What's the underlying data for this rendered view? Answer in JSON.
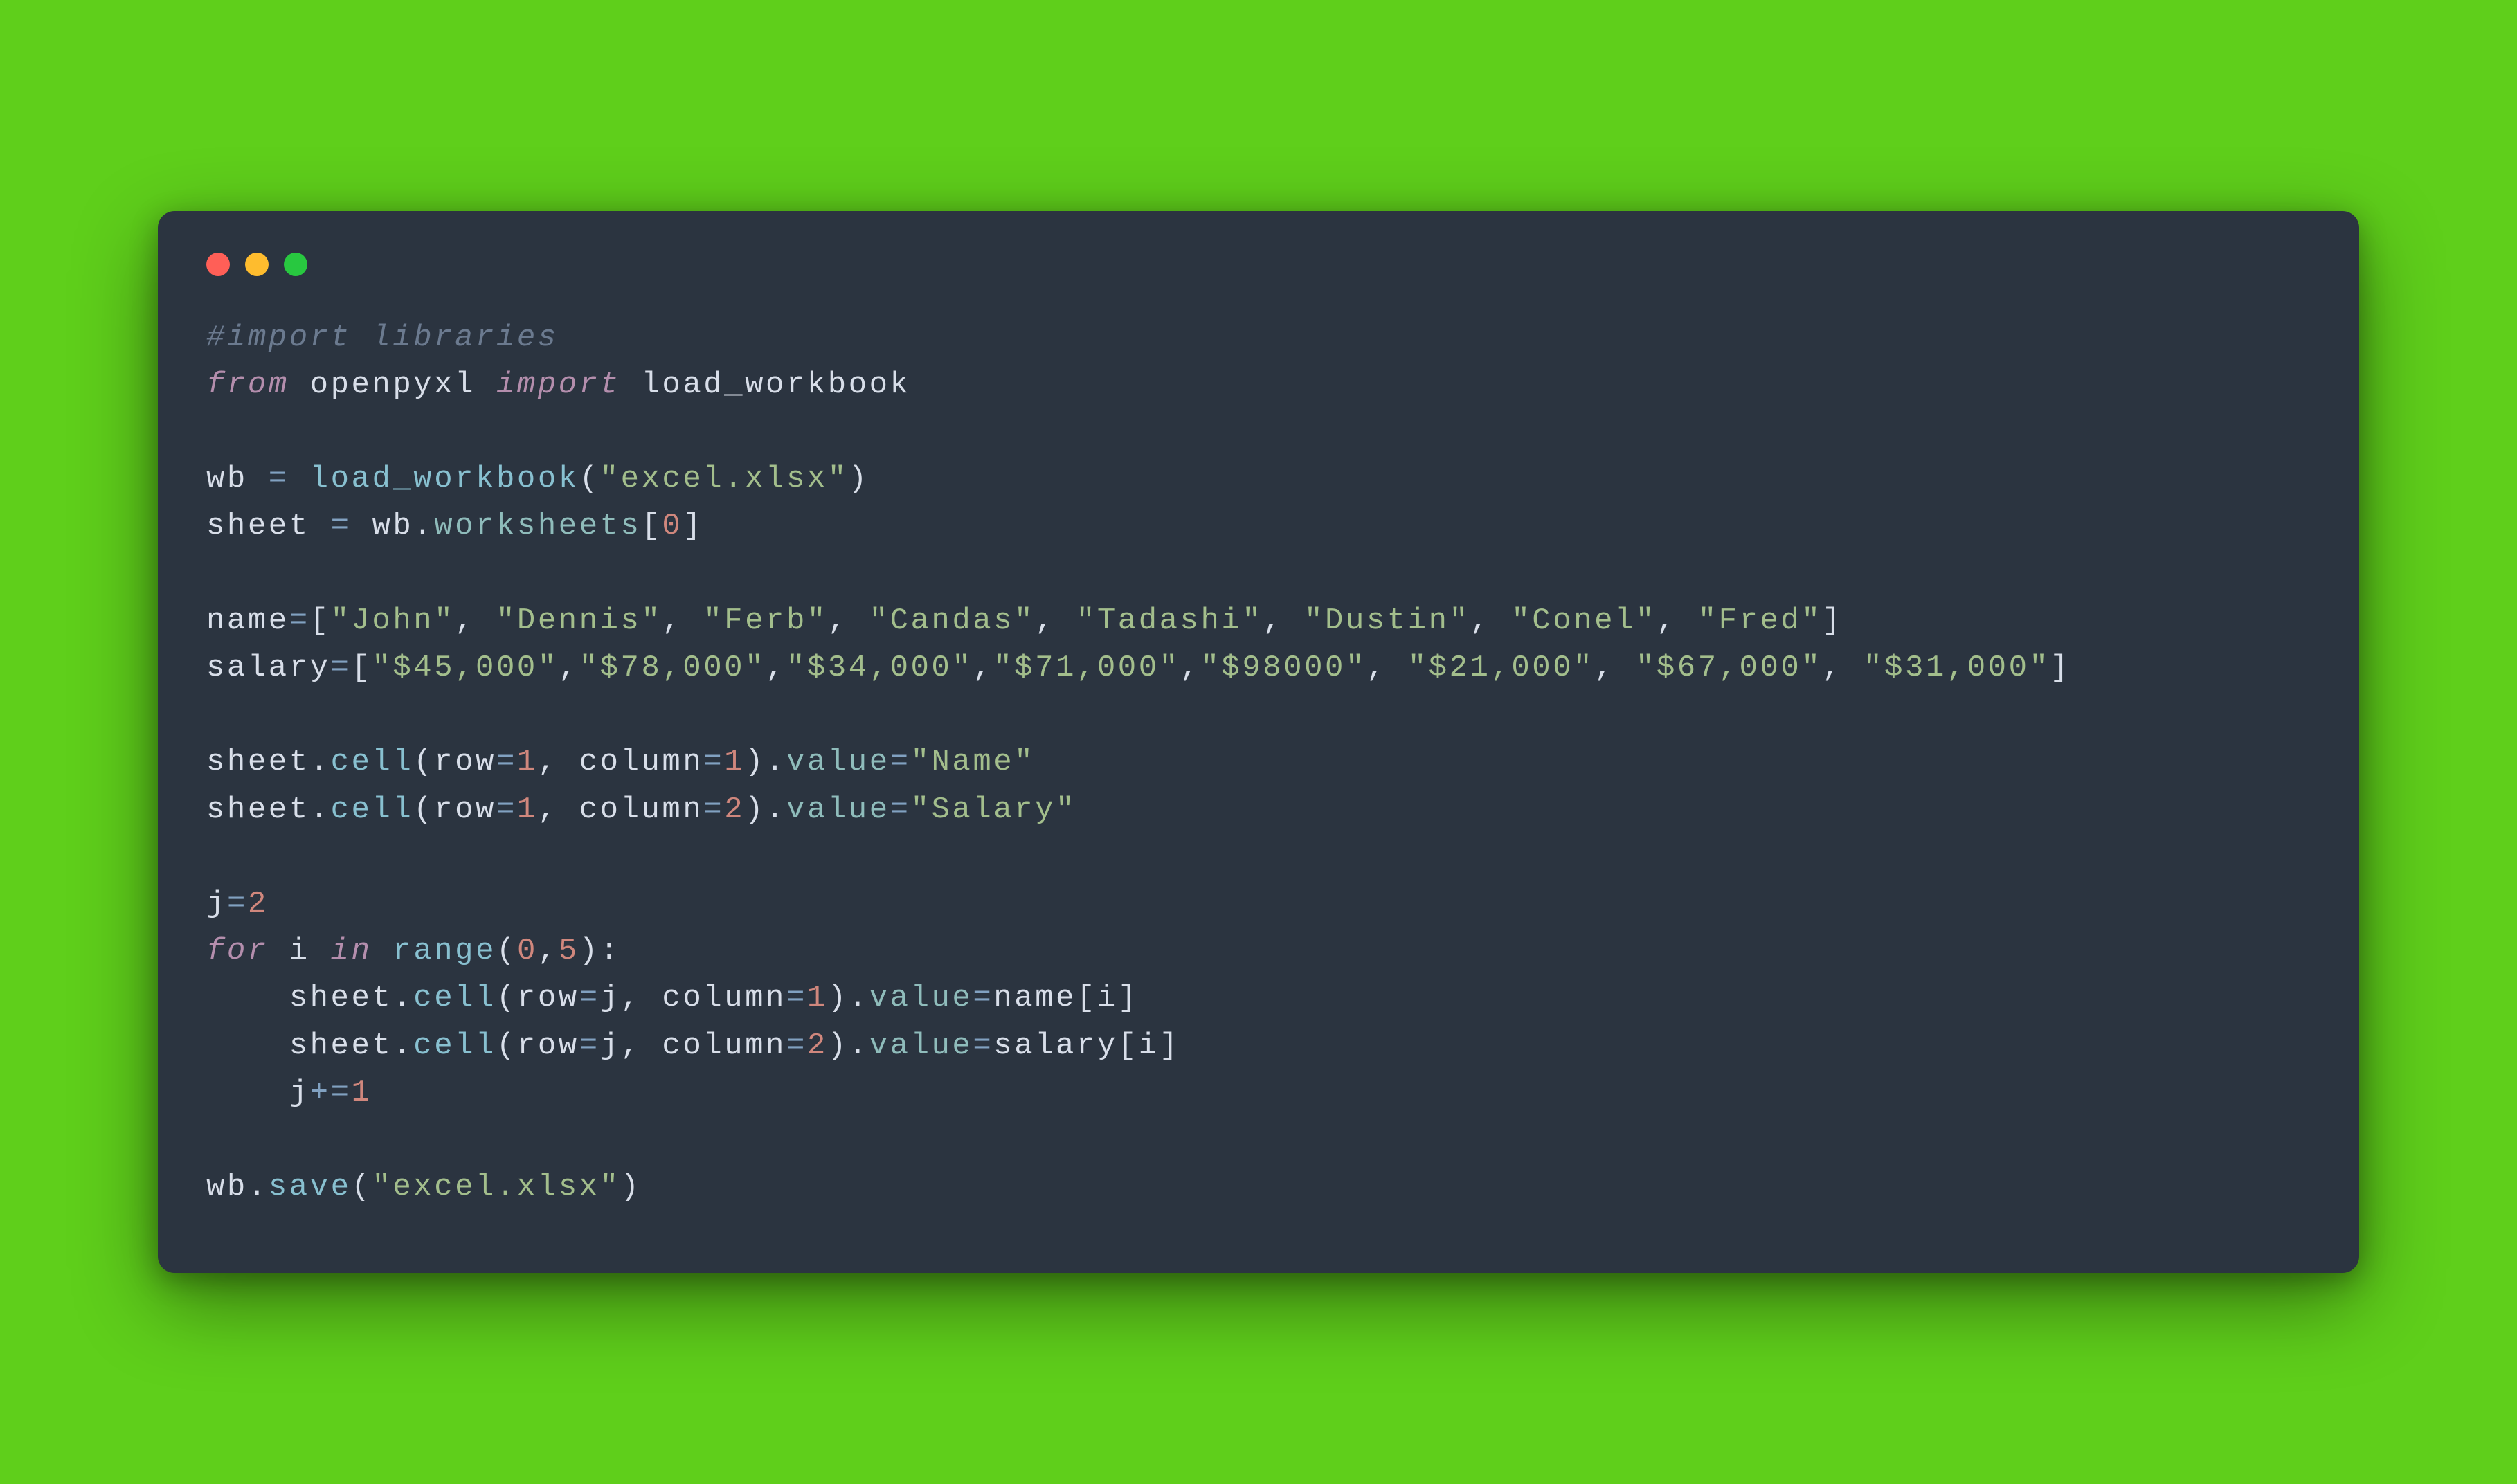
{
  "window": {
    "traffic_red": "close",
    "traffic_yellow": "minimize",
    "traffic_green": "zoom"
  },
  "code": {
    "l1_comment": "#import libraries",
    "l2_from": "from",
    "l2_mod": "openpyxl",
    "l2_import": "import",
    "l2_name": "load_workbook",
    "l4_wb": "wb",
    "l4_eq": "=",
    "l4_func": "load_workbook",
    "l4_lp": "(",
    "l4_str": "\"excel.xlsx\"",
    "l4_rp": ")",
    "l5_sheet": "sheet",
    "l5_eq": "=",
    "l5_wb": "wb",
    "l5_dot": ".",
    "l5_ws": "worksheets",
    "l5_lb": "[",
    "l5_idx": "0",
    "l5_rb": "]",
    "l7_name": "name",
    "l7_eq": "=",
    "l7_lb": "[",
    "l7_s1": "\"John\"",
    "l7_c1": ", ",
    "l7_s2": "\"Dennis\"",
    "l7_c2": ", ",
    "l7_s3": "\"Ferb\"",
    "l7_c3": ", ",
    "l7_s4": "\"Candas\"",
    "l7_c4": ", ",
    "l7_s5": "\"Tadashi\"",
    "l7_c5": ", ",
    "l7_s6": "\"Dustin\"",
    "l7_c6": ", ",
    "l7_s7": "\"Conel\"",
    "l7_c7": ", ",
    "l7_s8": "\"Fred\"",
    "l7_rb": "]",
    "l8_salary": "salary",
    "l8_eq": "=",
    "l8_lb": "[",
    "l8_s1": "\"$45,000\"",
    "l8_c1": ",",
    "l8_s2": "\"$78,000\"",
    "l8_c2": ",",
    "l8_s3": "\"$34,000\"",
    "l8_c3": ",",
    "l8_s4": "\"$71,000\"",
    "l8_c4": ",",
    "l8_s5": "\"$98000\"",
    "l8_c5": ", ",
    "l8_s6": "\"$21,000\"",
    "l8_c6": ", ",
    "l8_s7": "\"$67,000\"",
    "l8_c7": ", ",
    "l8_s8": "\"$31,000\"",
    "l8_rb": "]",
    "l10_sheet": "sheet",
    "l10_dot1": ".",
    "l10_cell": "cell",
    "l10_lp": "(",
    "l10_row": "row",
    "l10_eq1": "=",
    "l10_r": "1",
    "l10_comma": ", ",
    "l10_col": "column",
    "l10_eq2": "=",
    "l10_c": "1",
    "l10_rp": ")",
    "l10_dot2": ".",
    "l10_value": "value",
    "l10_eq3": "=",
    "l10_str": "\"Name\"",
    "l11_sheet": "sheet",
    "l11_dot1": ".",
    "l11_cell": "cell",
    "l11_lp": "(",
    "l11_row": "row",
    "l11_eq1": "=",
    "l11_r": "1",
    "l11_comma": ", ",
    "l11_col": "column",
    "l11_eq2": "=",
    "l11_c": "2",
    "l11_rp": ")",
    "l11_dot2": ".",
    "l11_value": "value",
    "l11_eq3": "=",
    "l11_str": "\"Salary\"",
    "l13_j": "j",
    "l13_eq": "=",
    "l13_v": "2",
    "l14_for": "for",
    "l14_i": "i",
    "l14_in": "in",
    "l14_range": "range",
    "l14_lp": "(",
    "l14_a": "0",
    "l14_comma": ",",
    "l14_b": "5",
    "l14_rp": ")",
    "l14_colon": ":",
    "l15_indent": "    ",
    "l15_sheet": "sheet",
    "l15_dot1": ".",
    "l15_cell": "cell",
    "l15_lp": "(",
    "l15_row": "row",
    "l15_eq1": "=",
    "l15_r": "j",
    "l15_comma": ", ",
    "l15_col": "column",
    "l15_eq2": "=",
    "l15_c": "1",
    "l15_rp": ")",
    "l15_dot2": ".",
    "l15_value": "value",
    "l15_eq3": "=",
    "l15_name": "name",
    "l15_lb": "[",
    "l15_idx": "i",
    "l15_rb": "]",
    "l16_indent": "    ",
    "l16_sheet": "sheet",
    "l16_dot1": ".",
    "l16_cell": "cell",
    "l16_lp": "(",
    "l16_row": "row",
    "l16_eq1": "=",
    "l16_r": "j",
    "l16_comma": ", ",
    "l16_col": "column",
    "l16_eq2": "=",
    "l16_c": "2",
    "l16_rp": ")",
    "l16_dot2": ".",
    "l16_value": "value",
    "l16_eq3": "=",
    "l16_salary": "salary",
    "l16_lb": "[",
    "l16_idx": "i",
    "l16_rb": "]",
    "l17_indent": "    ",
    "l17_j": "j",
    "l17_op": "+=",
    "l17_v": "1",
    "l19_wb": "wb",
    "l19_dot": ".",
    "l19_save": "save",
    "l19_lp": "(",
    "l19_str": "\"excel.xlsx\"",
    "l19_rp": ")"
  }
}
